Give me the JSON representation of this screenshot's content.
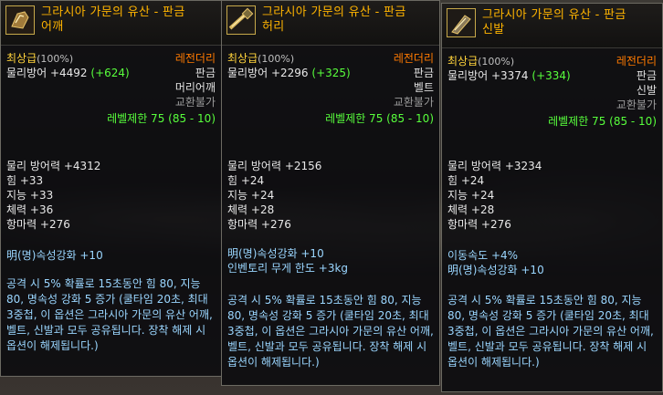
{
  "tooltips": [
    {
      "name_line1": "그라시아 가문의 유산 - 판금",
      "name_line2": "어깨",
      "icon": "shoulder-armor-icon",
      "grade": "최상급",
      "grade_pct": "(100%)",
      "rarity": "레전더리",
      "defense_label": "물리방어 +4492",
      "defense_bonus": "(+624)",
      "armor_type": "판금",
      "slot": "머리어깨",
      "trade": "교환불가",
      "level_limit": "레벨제한 75 (85 - 10)",
      "stats": [
        "물리 방어력 +4312",
        "힘 +33",
        "지능 +33",
        "체력 +36",
        "항마력 +276"
      ],
      "enchants": [
        "明(명)속성강화 +10"
      ],
      "description": "공격 시 5% 확률로 15초동안 힘 80, 지능 80, 명속성 강화 5 증가 (쿨타임 20초, 최대 3중첩, 이 옵션은 그라시아 가문의 유산 어깨, 벨트, 신발과 모두 공유됩니다. 장착 해제 시 옵션이 해제됩니다.)"
    },
    {
      "name_line1": "그라시아 가문의 유산 - 판금",
      "name_line2": "허리",
      "icon": "belt-armor-icon",
      "grade": "최상급",
      "grade_pct": "(100%)",
      "rarity": "레전더리",
      "defense_label": "물리방어 +2296",
      "defense_bonus": "(+325)",
      "armor_type": "판금",
      "slot": "벨트",
      "trade": "교환불가",
      "level_limit": "레벨제한 75 (85 - 10)",
      "stats": [
        "물리 방어력 +2156",
        "힘 +24",
        "지능 +24",
        "체력 +28",
        "항마력 +276"
      ],
      "enchants": [
        "明(명)속성강화 +10",
        "인벤토리 무게 한도 +3kg"
      ],
      "description": "공격 시 5% 확률로 15초동안 힘 80, 지능 80, 명속성 강화 5 증가 (쿨타임 20초, 최대 3중첩, 이 옵션은 그라시아 가문의 유산 어깨, 벨트, 신발과 모두 공유됩니다. 장착 해제 시 옵션이 해제됩니다.)"
    },
    {
      "name_line1": "그라시아 가문의 유산 - 판금",
      "name_line2": "신발",
      "icon": "boots-armor-icon",
      "grade": "최상급",
      "grade_pct": "(100%)",
      "rarity": "레전더리",
      "defense_label": "물리방어 +3374",
      "defense_bonus": "(+334)",
      "armor_type": "판금",
      "slot": "신발",
      "trade": "교환불가",
      "level_limit": "레벨제한 75 (85 - 10)",
      "stats": [
        "물리 방어력 +3234",
        "힘 +24",
        "지능 +24",
        "체력 +28",
        "항마력 +276"
      ],
      "enchants": [
        "이동속도 +4%",
        "明(명)속성강화 +10"
      ],
      "description": "공격 시 5% 확률로 15초동안 힘 80, 지능 80, 명속성 강화 5 증가 (쿨타임 20초, 최대 3중첩, 이 옵션은 그라시아 가문의 유산 어깨, 벨트, 신발과 모두 공유됩니다. 장착 해제 시 옵션이 해제됩니다.)"
    }
  ],
  "colors": {
    "name": "#ffb400",
    "grade": "#ffd33b",
    "rarity": "#ff7a00",
    "green": "#58ff3c",
    "enchant": "#9ad6ff"
  }
}
